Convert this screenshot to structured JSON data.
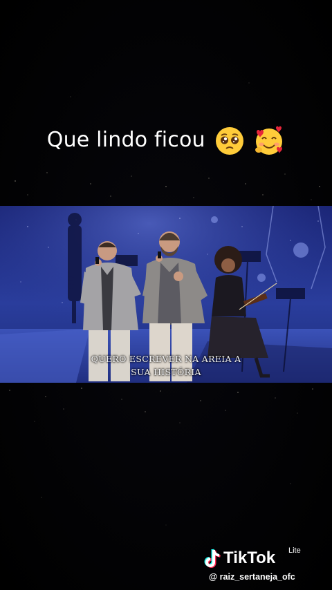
{
  "caption": {
    "text": "Que lindo ficou",
    "emojis": [
      "pleading-face-icon",
      "smiling-face-with-hearts-icon"
    ]
  },
  "video": {
    "subtitle_line1": "QUERO ESCREVER NA AREIA A",
    "subtitle_line2": "SUA HISTÓRIA"
  },
  "watermark": {
    "brand": "TikTok",
    "tag": "Lite",
    "username": "@ raiz_sertaneja_ofc"
  },
  "colors": {
    "background": "#020204",
    "stage_blue": "#2a3d9c",
    "caption_text": "#ffffff"
  }
}
